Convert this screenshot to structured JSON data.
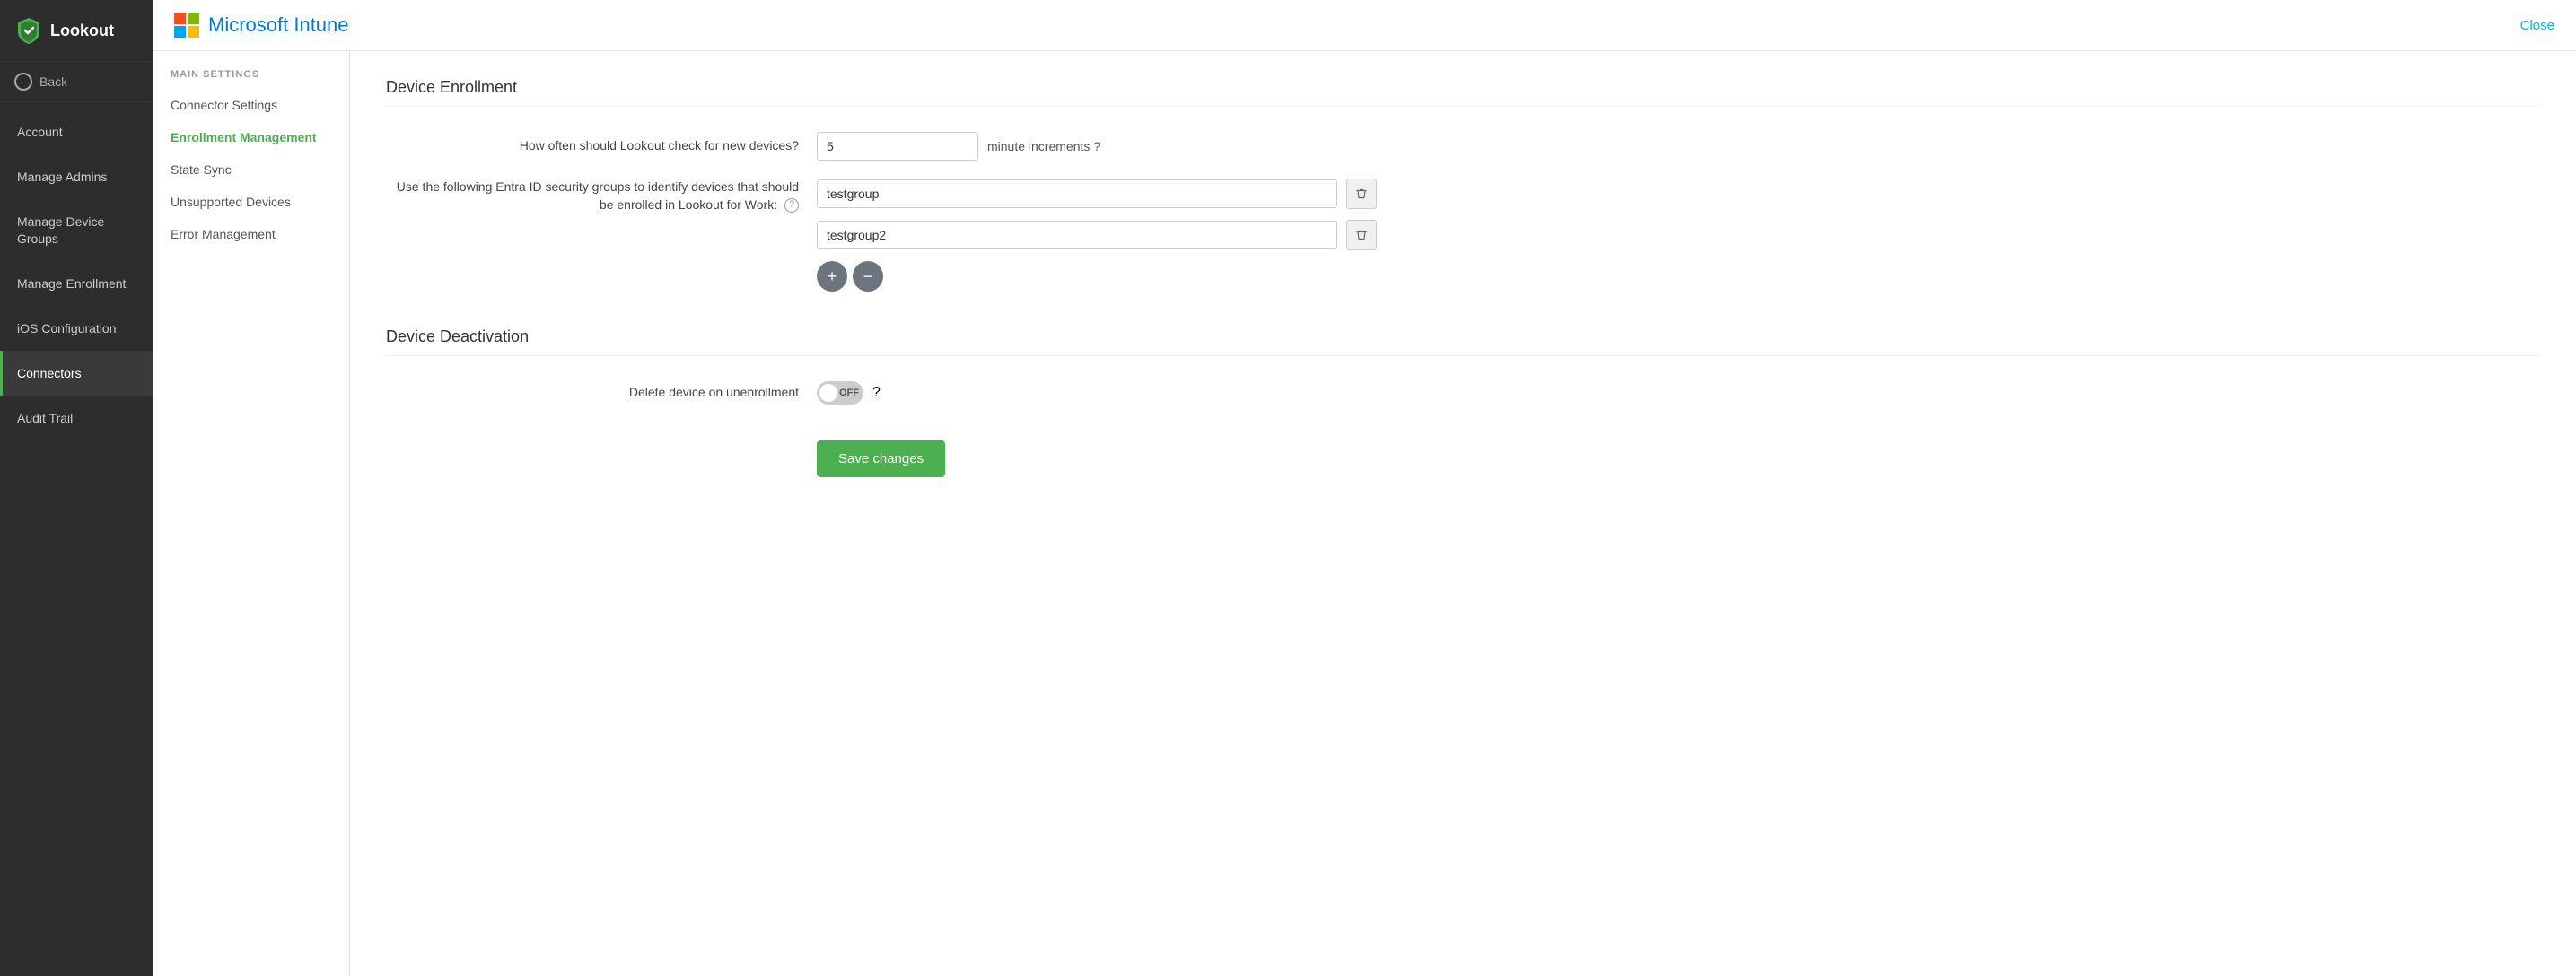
{
  "sidebar": {
    "logo_text": "Lookout",
    "back_label": "Back",
    "items": [
      {
        "id": "account",
        "label": "Account",
        "active": false
      },
      {
        "id": "manage-admins",
        "label": "Manage Admins",
        "active": false
      },
      {
        "id": "manage-device-groups",
        "label": "Manage Device Groups",
        "active": false
      },
      {
        "id": "manage-enrollment",
        "label": "Manage Enrollment",
        "active": false
      },
      {
        "id": "ios-configuration",
        "label": "iOS Configuration",
        "active": false
      },
      {
        "id": "connectors",
        "label": "Connectors",
        "active": true
      },
      {
        "id": "audit-trail",
        "label": "Audit Trail",
        "active": false
      }
    ]
  },
  "header": {
    "brand": "Microsoft Intune",
    "close_label": "Close"
  },
  "sub_nav": {
    "section_label": "MAIN SETTINGS",
    "items": [
      {
        "id": "connector-settings",
        "label": "Connector Settings",
        "active": false
      },
      {
        "id": "enrollment-management",
        "label": "Enrollment Management",
        "active": true
      },
      {
        "id": "state-sync",
        "label": "State Sync",
        "active": false
      },
      {
        "id": "unsupported-devices",
        "label": "Unsupported Devices",
        "active": false
      },
      {
        "id": "error-management",
        "label": "Error Management",
        "active": false
      }
    ]
  },
  "page": {
    "device_enrollment_title": "Device Enrollment",
    "check_frequency_label": "How often should Lookout check for new devices?",
    "check_frequency_value": "5",
    "minute_increments_label": "minute increments",
    "groups_label": "Use the following Entra ID security groups to identify devices that should be enrolled in Lookout for Work:",
    "groups": [
      {
        "value": "testgroup"
      },
      {
        "value": "testgroup2"
      }
    ],
    "add_label": "+",
    "remove_label": "−",
    "device_deactivation_title": "Device Deactivation",
    "delete_on_unenroll_label": "Delete device on unenrollment",
    "toggle_state": "OFF",
    "save_label": "Save changes"
  }
}
